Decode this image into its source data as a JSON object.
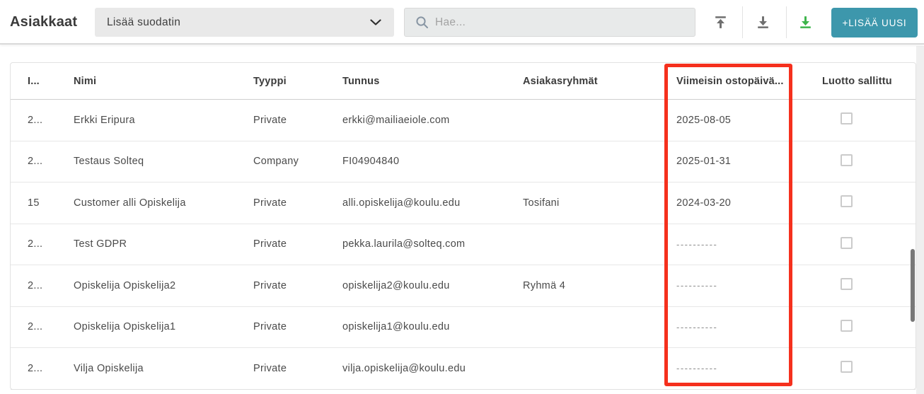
{
  "header": {
    "title": "Asiakkaat",
    "filter_dropdown": {
      "label": "Lisää suodatin"
    },
    "search": {
      "placeholder": "Hae...",
      "value": ""
    },
    "add_button_label": "+LISÄÄ UUSI"
  },
  "icons": {
    "chevron_down": "chevron-down",
    "search": "magnifier",
    "upload": "arrow-up-to-line",
    "download": "arrow-down-to-line",
    "export_green": "arrow-down-to-line"
  },
  "table": {
    "columns": [
      "I...",
      "Nimi",
      "Tyyppi",
      "Tunnus",
      "Asiakasryhmät",
      "Viimeisin ostopäivä...",
      "Luotto sallittu"
    ],
    "rows": [
      {
        "id": "2...",
        "nimi": "Erkki Eripura",
        "tyyppi": "Private",
        "tunnus": "erkki@mailiaeiole.com",
        "ryhmat": "",
        "viimeisin": "2025-08-05",
        "luotto": false
      },
      {
        "id": "2...",
        "nimi": "Testaus Solteq",
        "tyyppi": "Company",
        "tunnus": "FI04904840",
        "ryhmat": "",
        "viimeisin": "2025-01-31",
        "luotto": false
      },
      {
        "id": "15",
        "nimi": "Customer alli Opiskelija",
        "tyyppi": "Private",
        "tunnus": "alli.opiskelija@koulu.edu",
        "ryhmat": "Tosifani",
        "viimeisin": "2024-03-20",
        "luotto": false
      },
      {
        "id": "2...",
        "nimi": "Test GDPR",
        "tyyppi": "Private",
        "tunnus": "pekka.laurila@solteq.com",
        "ryhmat": "",
        "viimeisin": "----------",
        "luotto": false
      },
      {
        "id": "2...",
        "nimi": "Opiskelija Opiskelija2",
        "tyyppi": "Private",
        "tunnus": "opiskelija2@koulu.edu",
        "ryhmat": "Ryhmä 4",
        "viimeisin": "----------",
        "luotto": false
      },
      {
        "id": "2...",
        "nimi": "Opiskelija Opiskelija1",
        "tyyppi": "Private",
        "tunnus": "opiskelija1@koulu.edu",
        "ryhmat": "",
        "viimeisin": "----------",
        "luotto": false
      },
      {
        "id": "2...",
        "nimi": "Vilja Opiskelija",
        "tyyppi": "Private",
        "tunnus": "vilja.opiskelija@koulu.edu",
        "ryhmat": "",
        "viimeisin": "----------",
        "luotto": false
      }
    ]
  },
  "annotation": {
    "highlighted_column": "Viimeisin ostopäivä..."
  },
  "colors": {
    "accent_teal": "#3d97ac",
    "icon_green": "#3cb44a",
    "icon_gray": "#6f6f6f",
    "highlight_red": "#f5301d",
    "box_gray": "#e9e9e9",
    "scrollbar_thumb": "#787878"
  }
}
